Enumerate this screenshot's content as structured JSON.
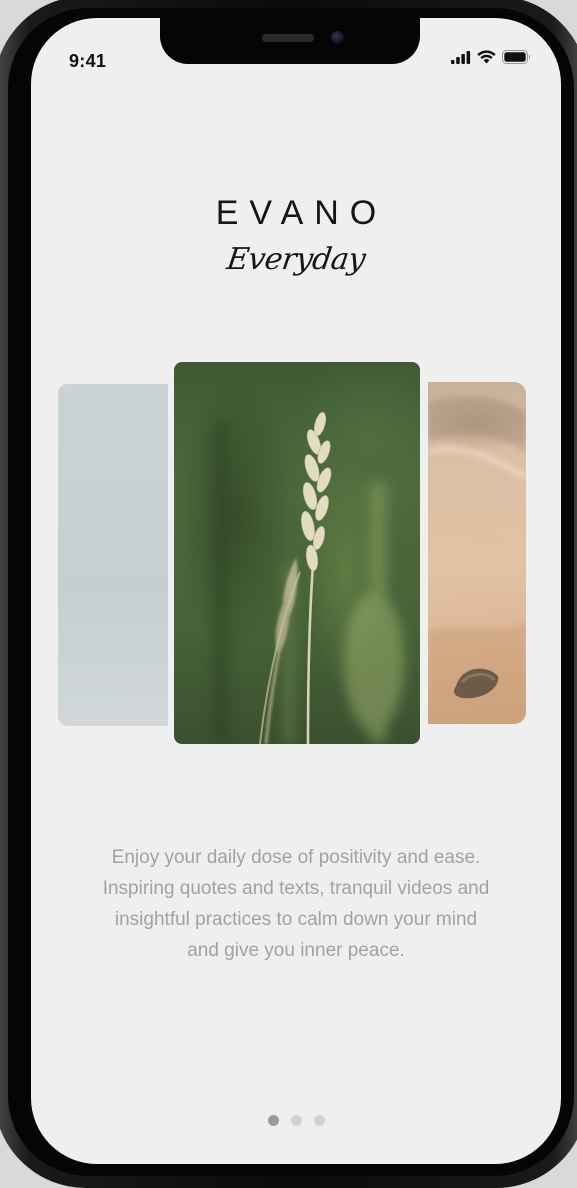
{
  "status_bar": {
    "time": "9:41",
    "icons": [
      "cellular-signal-icon",
      "wifi-icon",
      "battery-icon"
    ]
  },
  "brand": {
    "logo": "EVANO",
    "tagline": "Everyday"
  },
  "carousel": {
    "cards": [
      {
        "name": "misty-sky-image"
      },
      {
        "name": "grass-stem-image"
      },
      {
        "name": "sand-shore-image"
      }
    ],
    "active_index": 1
  },
  "description": "Enjoy your daily dose of positivity and ease. Inspiring quotes and texts, tranquil videos and insightful practices to calm down your mind and give you inner peace.",
  "pagination": {
    "total": 3,
    "active": 1
  },
  "colors": {
    "background": "#efefef",
    "text_primary": "#151515",
    "text_muted": "#a2a2a2",
    "dot_active": "#9a9a9a",
    "dot_inactive": "#d2d2d2"
  }
}
